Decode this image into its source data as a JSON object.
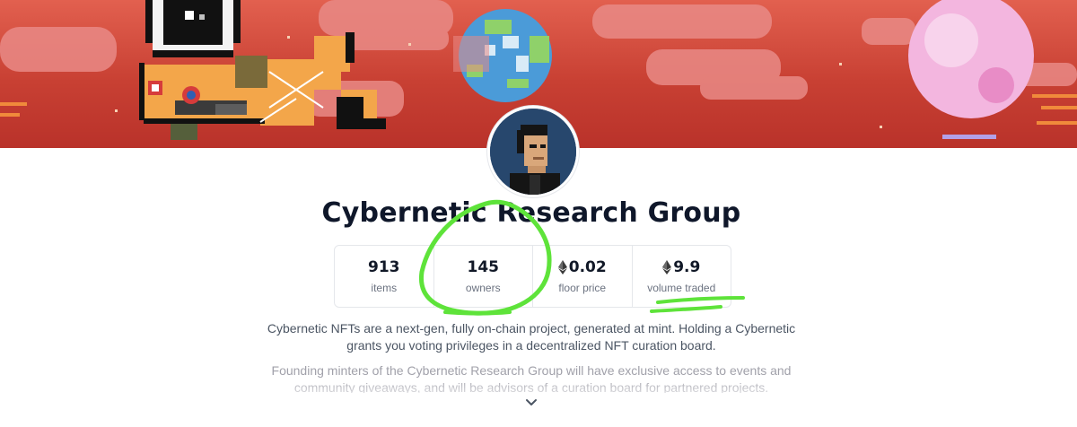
{
  "collection": {
    "title": "Cybernetic Research Group"
  },
  "stats": [
    {
      "value": "913",
      "label": "items",
      "has_eth_icon": false
    },
    {
      "value": "145",
      "label": "owners",
      "has_eth_icon": false
    },
    {
      "value": "0.02",
      "label": "floor price",
      "has_eth_icon": true
    },
    {
      "value": "9.9",
      "label": "volume traded",
      "has_eth_icon": true
    }
  ],
  "description": {
    "paragraph1": "Cybernetic NFTs are a next-gen, fully on-chain project, generated at mint. Holding a Cybernetic grants you voting privileges in a decentralized NFT curation board.",
    "paragraph2": "Founding minters of the Cybernetic Research Group will have exclusive access to events and community giveaways, and will be advisors of a curation board for partnered projects."
  },
  "icons": {
    "eth": "ethereum-icon",
    "expand": "chevron-down-icon"
  },
  "colors": {
    "annotation": "#5ee33a",
    "banner_red": "#c84033",
    "title": "#0f172a"
  }
}
